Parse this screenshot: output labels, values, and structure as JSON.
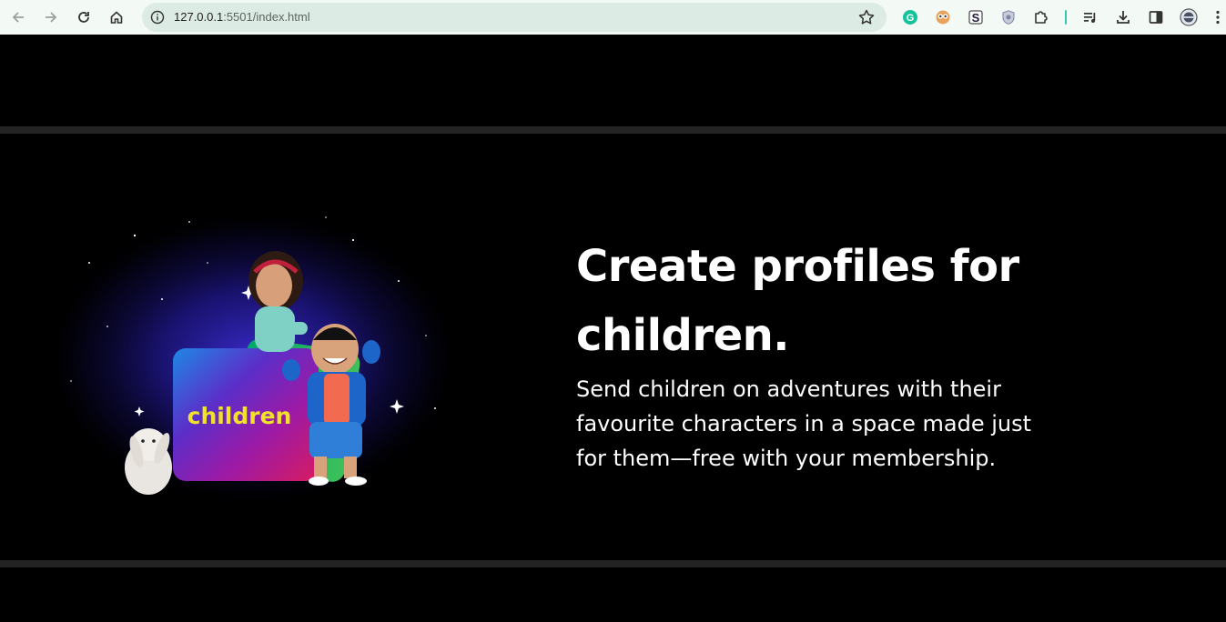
{
  "browser": {
    "url_host": "127.0.0.1",
    "url_path": ":5501/index.html",
    "nav_icons": [
      "back-icon",
      "forward-icon",
      "reload-icon",
      "home-icon"
    ],
    "extension_icons": [
      "grammarly-icon",
      "owl-extension-icon",
      "s-extension-icon",
      "shield-extension-icon",
      "extensions-puzzle-icon",
      "media-queue-icon",
      "download-icon",
      "side-panel-icon",
      "profile-avatar-icon",
      "kebab-menu-icon"
    ]
  },
  "feature": {
    "heading": "Create profiles for children.",
    "body": "Send children on adventures with their favourite characters in a space made just for them—free with your membership.",
    "image_label": "children"
  },
  "colors": {
    "page_bg": "#000000",
    "divider": "#232323",
    "text": "#ffffff",
    "chrome_bg": "#f3faf6",
    "omnibox_bg": "#dcebe3",
    "children_label": "#f2e12b"
  }
}
